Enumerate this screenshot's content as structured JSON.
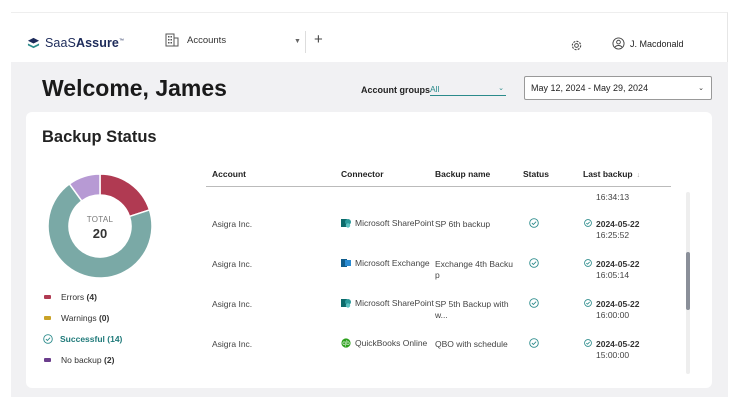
{
  "app": {
    "logo_light": "SaaS",
    "logo_bold": "Assure",
    "logo_tm": "™",
    "account_selector": "Accounts",
    "user_name": "J. Macdonald"
  },
  "header": {
    "welcome": "Welcome, James",
    "account_groups_label": "Account groups",
    "account_groups_value": "All",
    "date_range": "May 12, 2024 - May 29, 2024"
  },
  "backup_status": {
    "title": "Backup Status",
    "total_label": "TOTAL",
    "total_value": "20",
    "legend": [
      {
        "label": "Errors",
        "count": "(4)",
        "color": "#b03a52"
      },
      {
        "label": "Warnings",
        "count": "(0)",
        "color": "#c9a227"
      },
      {
        "label": "Successful",
        "count": "(14)",
        "color": "#2b8b8b"
      },
      {
        "label": "No backup",
        "count": "(2)",
        "color": "#6b3d8c"
      }
    ],
    "chart_data": {
      "type": "pie",
      "categories": [
        "Errors",
        "Warnings",
        "Successful",
        "No backup"
      ],
      "values": [
        4,
        0,
        14,
        2
      ],
      "colors": [
        "#b03a52",
        "#c9a227",
        "#7aa9a6",
        "#b79ad4"
      ]
    }
  },
  "table": {
    "columns": [
      "Account",
      "Connector",
      "Backup name",
      "Status",
      "Last backup"
    ],
    "sort_indicator": "↓",
    "partial_top_time": "16:34:13",
    "rows": [
      {
        "account": "Asigra Inc.",
        "connector": "Microsoft SharePoint",
        "connector_icon": "sharepoint-icon",
        "backup_name_1": "SP 6th backup",
        "backup_name_2": "",
        "date": "2024-05-22",
        "time": "16:25:52"
      },
      {
        "account": "Asigra Inc.",
        "connector": "Microsoft Exchange",
        "connector_icon": "exchange-icon",
        "backup_name_1": "Exchange 4th Backu",
        "backup_name_2": "p",
        "date": "2024-05-22",
        "time": "16:05:14"
      },
      {
        "account": "Asigra Inc.",
        "connector": "Microsoft SharePoint",
        "connector_icon": "sharepoint-icon",
        "backup_name_1": "SP 5th Backup with",
        "backup_name_2": "w...",
        "date": "2024-05-22",
        "time": "16:00:00"
      },
      {
        "account": "Asigra Inc.",
        "connector": "QuickBooks Online",
        "connector_icon": "quickbooks-icon",
        "backup_name_1": "QBO with schedule",
        "backup_name_2": "",
        "date": "2024-05-22",
        "time": "15:00:00"
      }
    ]
  }
}
